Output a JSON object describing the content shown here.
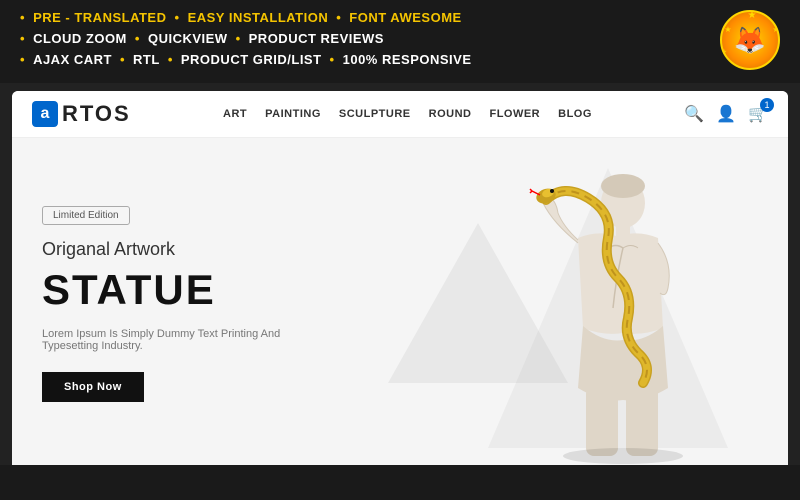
{
  "banner": {
    "row1": [
      {
        "label": "PRE - TRANSLATED",
        "color": "yellow"
      },
      {
        "dot": "•"
      },
      {
        "label": "EASY INSTALLATION",
        "color": "yellow"
      },
      {
        "dot": "•"
      },
      {
        "label": "FONT AWESOME",
        "color": "yellow"
      }
    ],
    "row2": [
      {
        "label": "CLOUD ZOOM",
        "color": "white"
      },
      {
        "dot": "•"
      },
      {
        "label": "QUICKVIEW",
        "color": "white"
      },
      {
        "dot": "•"
      },
      {
        "label": "PRODUCT REVIEWS",
        "color": "white"
      }
    ],
    "row3": [
      {
        "label": "AJAX CART",
        "color": "white"
      },
      {
        "dot": "•"
      },
      {
        "label": "RTL",
        "color": "white"
      },
      {
        "dot": "•"
      },
      {
        "label": "PRODUCT GRID/LIST",
        "color": "white"
      },
      {
        "dot": "•"
      },
      {
        "label": "100% RESPONSIVE",
        "color": "white"
      }
    ]
  },
  "logo": {
    "icon_letter": "a",
    "text": "RTOS"
  },
  "nav": {
    "links": [
      "ART",
      "PAINTING",
      "SCULPTURE",
      "ROUND",
      "FLOWER",
      "BLOG"
    ]
  },
  "hero": {
    "badge": "Limited Edition",
    "subtitle": "Origanal Artwork",
    "title": "STATUE",
    "description": "Lorem Ipsum Is Simply Dummy Text Printing And Typesetting Industry.",
    "button_label": "Shop Now"
  }
}
